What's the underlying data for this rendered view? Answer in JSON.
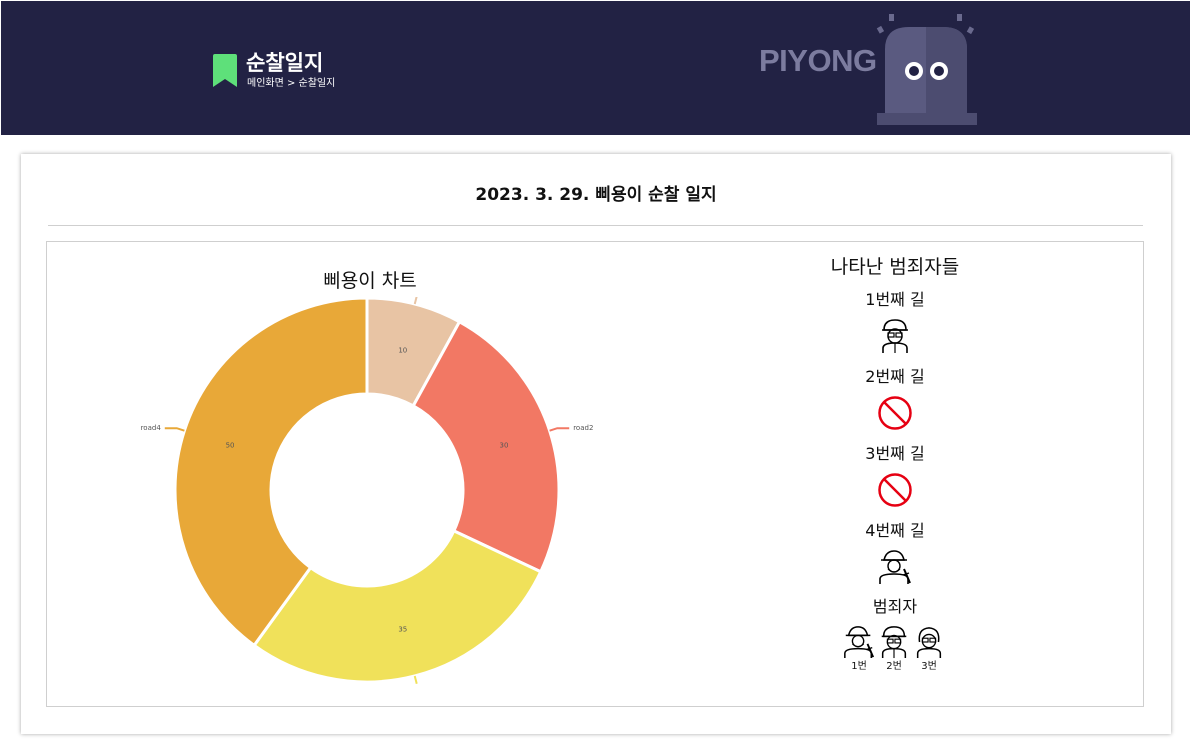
{
  "header": {
    "title": "순찰일지",
    "breadcrumb": "메인화면 > 순찰일지",
    "logo_text": "PIYONG",
    "bookmark_color": "#5ee07a",
    "background_color": "#222244"
  },
  "journal": {
    "title": "2023. 3. 29. 삐용이 순찰 일지"
  },
  "chart_data": {
    "type": "pie",
    "title": "삐용이 차트",
    "donut": true,
    "slices": [
      {
        "label": "",
        "value": 10,
        "color": "#e8c4a4"
      },
      {
        "label": "road2",
        "value": 30,
        "color": "#f27864"
      },
      {
        "label": "",
        "value": 35,
        "color": "#f0e15a"
      },
      {
        "label": "road4",
        "value": 50,
        "color": "#e8a838"
      }
    ]
  },
  "criminals_panel": {
    "title": "나타난 범죄자들",
    "roads": [
      {
        "label": "1번째 길",
        "icon": "criminal-2-icon"
      },
      {
        "label": "2번째 길",
        "icon": "no-sign-icon"
      },
      {
        "label": "3번째 길",
        "icon": "no-sign-icon"
      },
      {
        "label": "4번째 길",
        "icon": "criminal-1-icon"
      }
    ],
    "criminals_title": "범죄자",
    "criminals": [
      {
        "name": "1번",
        "icon": "criminal-1-icon"
      },
      {
        "name": "2번",
        "icon": "criminal-2-icon"
      },
      {
        "name": "3번",
        "icon": "criminal-3-icon"
      }
    ]
  }
}
